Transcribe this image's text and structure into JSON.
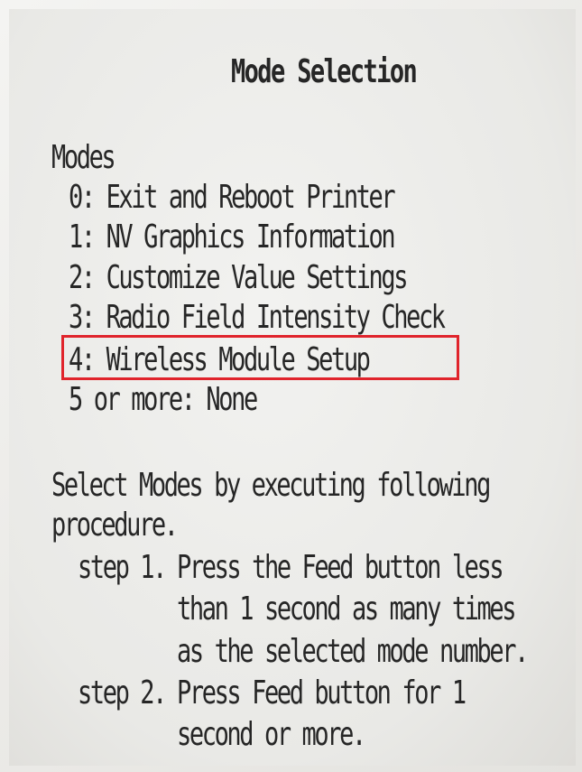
{
  "title": "Mode Selection",
  "modes": {
    "heading": "Modes",
    "items": [
      "0: Exit and Reboot Printer",
      "1: NV Graphics Information",
      "2: Customize Value Settings",
      "3: Radio Field Intensity Check",
      "4: Wireless Module Setup",
      "5 or more: None"
    ],
    "highlighted_index": 4
  },
  "instructions": {
    "line1": "Select Modes by executing following",
    "line2": "procedure.",
    "steps": [
      {
        "label": "step 1.",
        "lines": [
          "Press the Feed button less",
          "than 1 second as many times",
          "as the selected mode number."
        ]
      },
      {
        "label": "step 2.",
        "lines": [
          "Press Feed button for 1",
          "second or more."
        ]
      }
    ]
  },
  "colors": {
    "highlight_border": "#e0242c",
    "text": "#262626",
    "paper": "#ebebe8"
  }
}
